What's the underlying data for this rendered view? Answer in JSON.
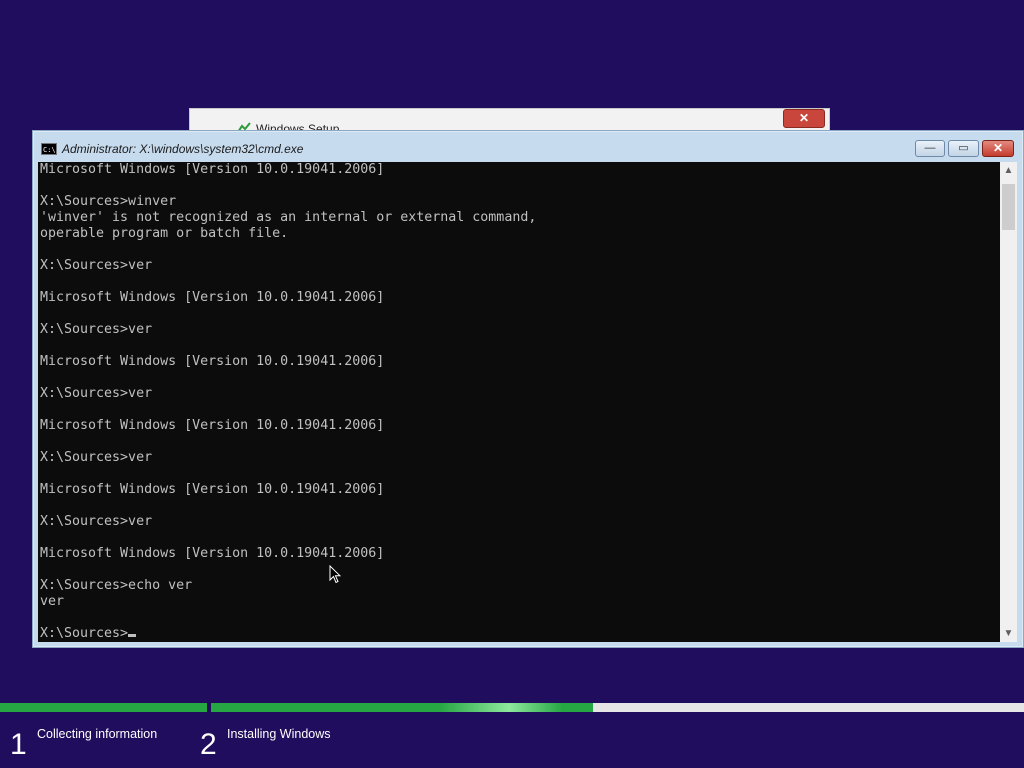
{
  "background_window": {
    "title": "Windows Setup",
    "close_glyph": "✕"
  },
  "cmd_window": {
    "title": "Administrator: X:\\windows\\system32\\cmd.exe",
    "icon_label": "C:\\",
    "buttons": {
      "minimize_glyph": "—",
      "maximize_glyph": "▭",
      "close_glyph": "✕"
    },
    "console_lines": [
      "Microsoft Windows [Version 10.0.19041.2006]",
      "",
      "X:\\Sources>winver",
      "'winver' is not recognized as an internal or external command,",
      "operable program or batch file.",
      "",
      "X:\\Sources>ver",
      "",
      "Microsoft Windows [Version 10.0.19041.2006]",
      "",
      "X:\\Sources>ver",
      "",
      "Microsoft Windows [Version 10.0.19041.2006]",
      "",
      "X:\\Sources>ver",
      "",
      "Microsoft Windows [Version 10.0.19041.2006]",
      "",
      "X:\\Sources>ver",
      "",
      "Microsoft Windows [Version 10.0.19041.2006]",
      "",
      "X:\\Sources>ver",
      "",
      "Microsoft Windows [Version 10.0.19041.2006]",
      "",
      "X:\\Sources>echo ver",
      "ver",
      ""
    ],
    "prompt": "X:\\Sources>",
    "scroll_up_glyph": "▲",
    "scroll_down_glyph": "▼"
  },
  "setup_progress": {
    "steps": [
      {
        "number": "1",
        "label": "Collecting information"
      },
      {
        "number": "2",
        "label": "Installing Windows"
      }
    ],
    "step1_fraction": 1.0,
    "step2_fraction": 0.47
  },
  "colors": {
    "desktop_bg": "#200d5e",
    "progress_green": "#27a644",
    "console_bg": "#0c0c0c",
    "console_fg": "#c0c0c0"
  }
}
